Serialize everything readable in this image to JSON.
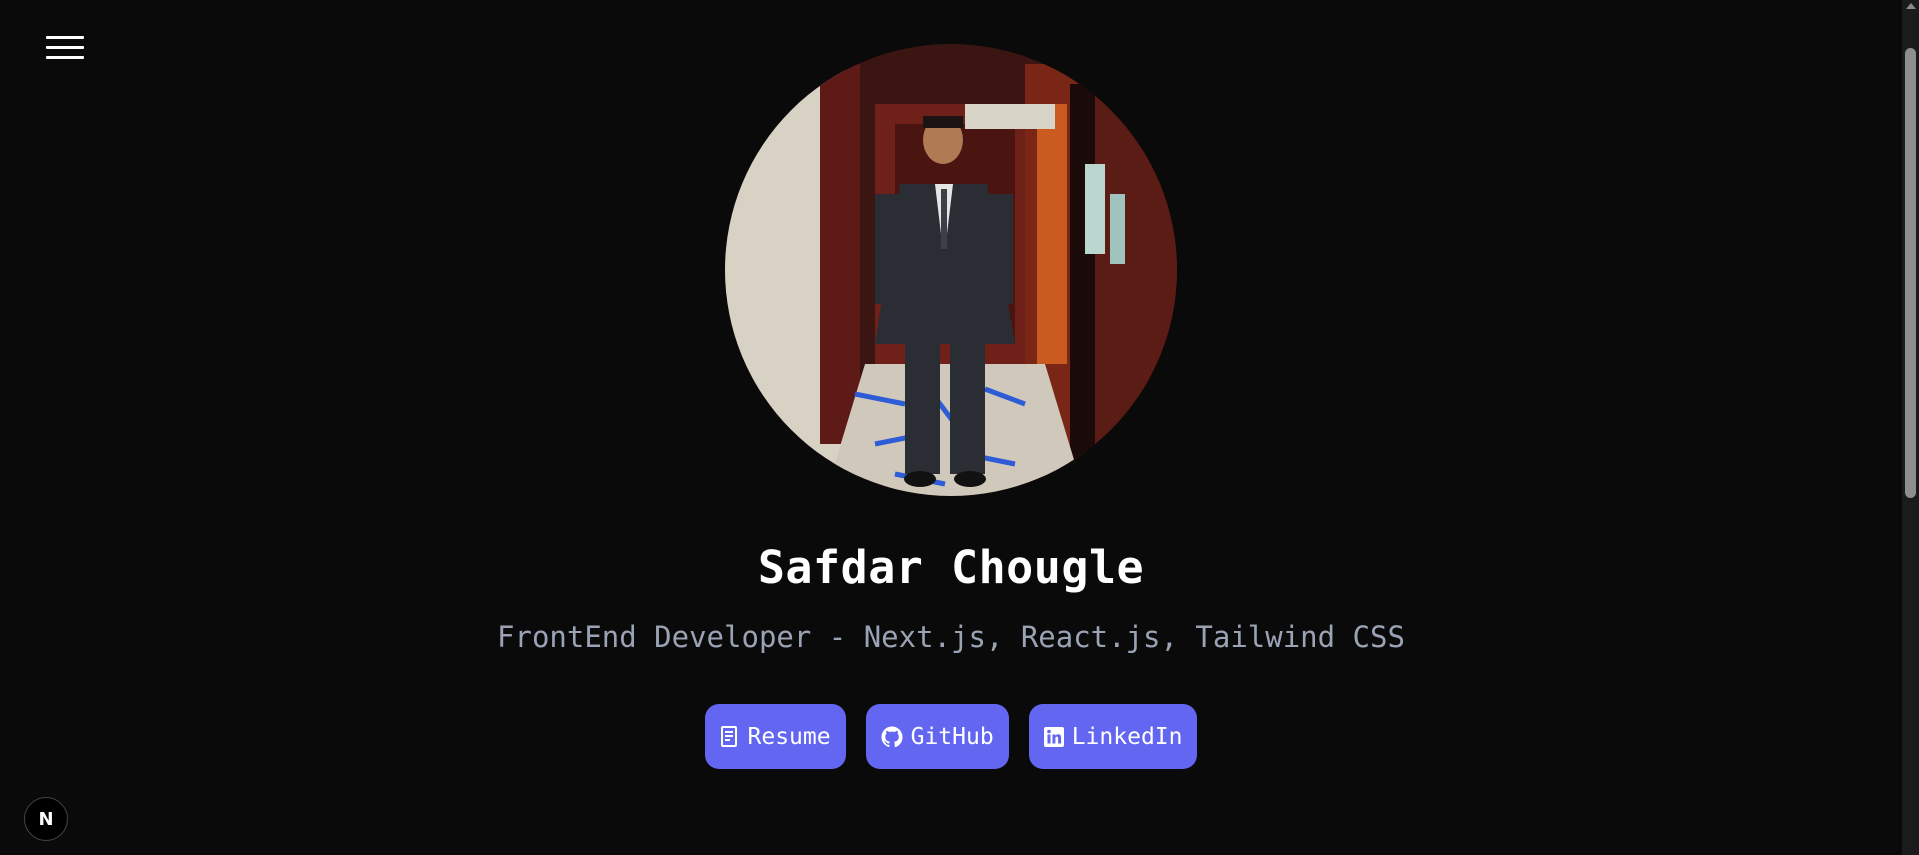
{
  "header": {
    "menu_icon": "hamburger-menu-icon"
  },
  "profile": {
    "photo_alt": "Safdar Chougle",
    "name": "Safdar Chougle",
    "subtitle": "FrontEnd Developer - Next.js, React.js, Tailwind CSS"
  },
  "links": [
    {
      "label": "Resume",
      "icon": "document-icon"
    },
    {
      "label": "GitHub",
      "icon": "github-icon"
    },
    {
      "label": "LinkedIn",
      "icon": "linkedin-icon"
    }
  ],
  "dev_badge": {
    "label": "N",
    "icon": "nextjs-logo-icon"
  },
  "colors": {
    "background": "#0a0a0b",
    "accent": "#6366f1",
    "subtitle": "#9aa3b3",
    "text": "#ffffff"
  }
}
